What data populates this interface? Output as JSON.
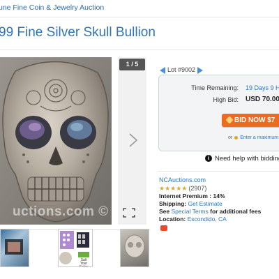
{
  "breadcrumb": "une Fine Coin & Jewelry Auction",
  "title": "99 Fine Silver Skull Bullion",
  "gallery": {
    "counter": "1 / 5",
    "watermark": "uctions.com ©"
  },
  "lot": {
    "label": "Lot #9002"
  },
  "bidding": {
    "time_label": "Time Remaining:",
    "time_value": "19 Days 9 H",
    "bid_label": "High Bid:",
    "bid_value": "USD 70.00",
    "button": "BID NOW $7",
    "or_text": "or",
    "alt_link": "Enter a maximum"
  },
  "help": "Need help with bidding",
  "seller": {
    "name": "NCAuctions.com",
    "stars": "★★★★★",
    "rating": "(2907)",
    "premium_label": "Internet Premium :",
    "premium_value": "14%",
    "shipping_label": "Shipping:",
    "shipping_value": "Get Estimate",
    "see_label": "See",
    "terms_link": "Special Terms",
    "terms_suffix": "for additional fees",
    "location_label": "Location:",
    "location_value": "Escondido, CA"
  },
  "thumb2_caption": "Salt Your Sales",
  "colors": {
    "link": "#2f74b9",
    "button": "#ee6a1e",
    "stars": "#e8a317"
  }
}
